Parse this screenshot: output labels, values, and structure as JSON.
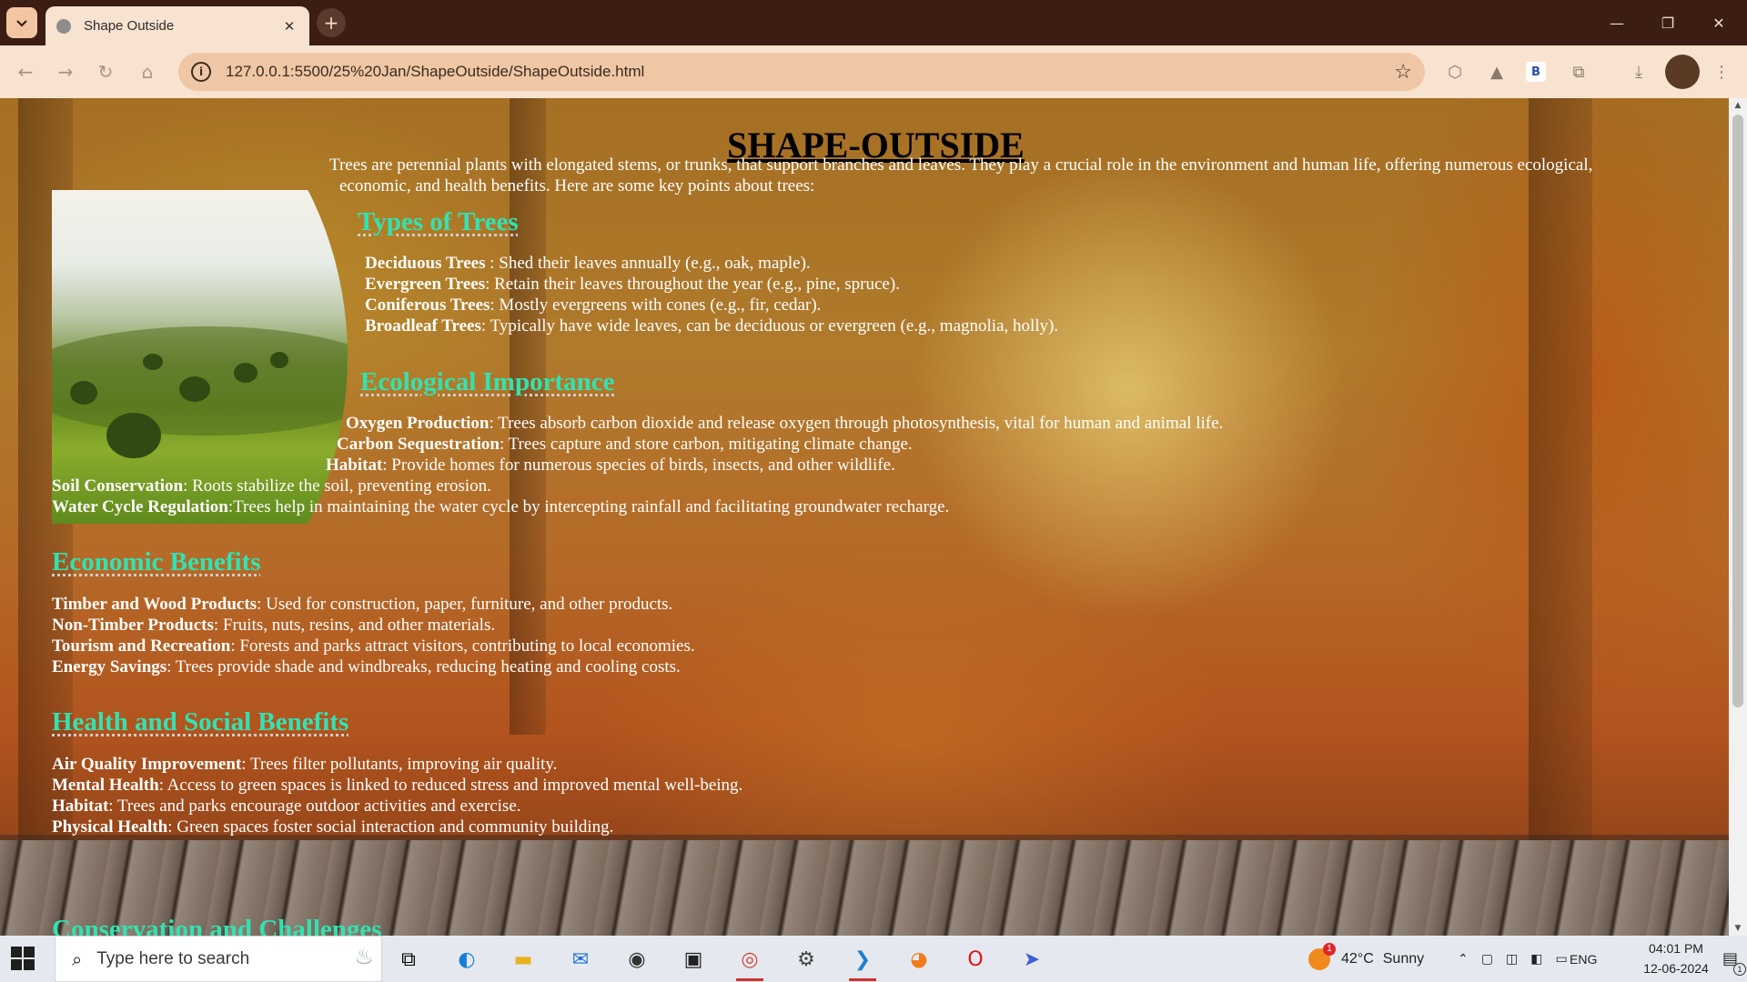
{
  "browser": {
    "tab_title": "Shape Outside",
    "url": "127.0.0.1:5500/25%20Jan/ShapeOutside/ShapeOutside.html"
  },
  "page": {
    "heading": "SHAPE-OUTSIDE",
    "intro": "Trees are perennial plants with elongated stems, or trunks, that support branches and leaves. They play a crucial role in the environment and human life, offering numerous ecological,",
    "intro2": "economic, and health benefits. Here are some key points about trees:",
    "sections": [
      {
        "title": "Types of Trees",
        "items": [
          {
            "term": "Deciduous Trees",
            "text": " : Shed their leaves annually (e.g., oak, maple)."
          },
          {
            "term": "Evergreen Trees",
            "text": ": Retain their leaves throughout the year (e.g., pine, spruce)."
          },
          {
            "term": "Coniferous Trees",
            "text": ": Mostly evergreens with cones (e.g., fir, cedar)."
          },
          {
            "term": "Broadleaf Trees",
            "text": ": Typically have wide leaves, can be deciduous or evergreen (e.g., magnolia, holly)."
          }
        ]
      },
      {
        "title": "Ecological Importance",
        "items": [
          {
            "term": "Oxygen Production",
            "text": ": Trees absorb carbon dioxide and release oxygen through photosynthesis, vital for human and animal life."
          },
          {
            "term": "Carbon Sequestration",
            "text": ": Trees capture and store carbon, mitigating climate change."
          },
          {
            "term": "Habitat",
            "text": ": Provide homes for numerous species of birds, insects, and other wildlife."
          },
          {
            "term": "Soil Conservation",
            "text": ": Roots stabilize the soil, preventing erosion."
          },
          {
            "term": "Water Cycle Regulation",
            "text": ":Trees help in maintaining the water cycle by intercepting rainfall and facilitating groundwater recharge."
          }
        ]
      },
      {
        "title": "Economic Benefits",
        "items": [
          {
            "term": "Timber and Wood Products",
            "text": ": Used for construction, paper, furniture, and other products."
          },
          {
            "term": "Non-Timber Products",
            "text": ": Fruits, nuts, resins, and other materials."
          },
          {
            "term": "Tourism and Recreation",
            "text": ": Forests and parks attract visitors, contributing to local economies."
          },
          {
            "term": "Energy Savings",
            "text": ": Trees provide shade and windbreaks, reducing heating and cooling costs."
          }
        ]
      },
      {
        "title": "Health and Social Benefits",
        "items": [
          {
            "term": "Air Quality Improvement",
            "text": ": Trees filter pollutants, improving air quality."
          },
          {
            "term": "Mental Health",
            "text": ": Access to green spaces is linked to reduced stress and improved mental well-being."
          },
          {
            "term": "Habitat",
            "text": ": Trees and parks encourage outdoor activities and exercise."
          },
          {
            "term": "Physical Health",
            "text": ": Green spaces foster social interaction and community building."
          }
        ]
      },
      {
        "title": "Conservation and Challenges",
        "items": []
      }
    ]
  },
  "taskbar": {
    "search_placeholder": "Type here to search",
    "weather_temp": "42°C",
    "weather_text": "Sunny",
    "weather_badge": "1",
    "language": "ENG",
    "time": "04:01 PM",
    "date": "12-06-2024",
    "notification_count": "1",
    "apps": [
      "task-view",
      "edge",
      "file-explorer",
      "mail",
      "obs",
      "terminal",
      "chrome",
      "settings",
      "vscode",
      "firefox",
      "opera",
      "send-app"
    ]
  },
  "colors": {
    "section_title": "#32e2b2",
    "tab_strip": "#3b1d14",
    "omnibox": "#f0c7a4"
  }
}
